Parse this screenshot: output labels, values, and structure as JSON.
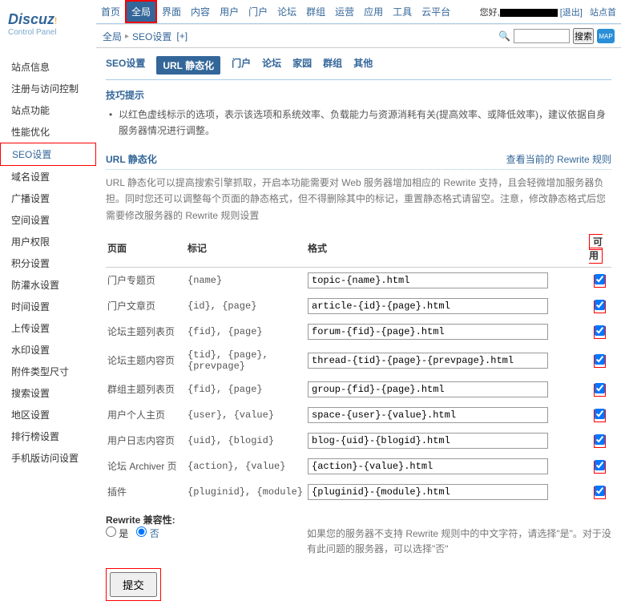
{
  "logo": {
    "main": "Discuz",
    "excl": "!",
    "sub": "Control Panel"
  },
  "topnav": {
    "items": [
      "首页",
      "全局",
      "界面",
      "内容",
      "用户",
      "门户",
      "论坛",
      "群组",
      "运营",
      "应用",
      "工具",
      "云平台"
    ],
    "active_index": 1
  },
  "user": {
    "hello": "您好,",
    "logout": "[退出]",
    "site_home": "站点首"
  },
  "breadcrumb": {
    "a": "全局",
    "b": "SEO设置",
    "plus": "[+]",
    "search_btn": "搜索",
    "map": "MAP"
  },
  "sidebar": {
    "items": [
      "站点信息",
      "注册与访问控制",
      "站点功能",
      "性能优化",
      "SEO设置",
      "域名设置",
      "广播设置",
      "空间设置",
      "用户权限",
      "积分设置",
      "防灌水设置",
      "时间设置",
      "上传设置",
      "水印设置",
      "附件类型尺寸",
      "搜索设置",
      "地区设置",
      "排行榜设置",
      "手机版访问设置"
    ],
    "active_index": 4
  },
  "tabs": {
    "items": [
      "SEO设置",
      "URL 静态化",
      "门户",
      "论坛",
      "家园",
      "群组",
      "其他"
    ],
    "active_index": 1
  },
  "tips": {
    "title": "技巧提示",
    "body": "以红色虚线标示的选项，表示该选项和系统效率、负载能力与资源消耗有关(提高效率、或降低效率)，建议依据自身服务器情况进行调整。"
  },
  "section": {
    "title": "URL 静态化",
    "right_link": "查看当前的 Rewrite 规则",
    "desc": "URL 静态化可以提高搜索引擎抓取，开启本功能需要对 Web 服务器增加相应的 Rewrite 支持，且会轻微增加服务器负担。同时您还可以调整每个页面的静态格式，但不得删除其中的标记，重置静态格式请留空。注意，修改静态格式后您需要修改服务器的 Rewrite 规则设置"
  },
  "table": {
    "headers": {
      "page": "页面",
      "tag": "标记",
      "format": "格式",
      "avail": "可用"
    },
    "rows": [
      {
        "page": "门户专题页",
        "tag": "{name}",
        "format": "topic-{name}.html",
        "avail": true
      },
      {
        "page": "门户文章页",
        "tag": "{id}, {page}",
        "format": "article-{id}-{page}.html",
        "avail": true
      },
      {
        "page": "论坛主题列表页",
        "tag": "{fid}, {page}",
        "format": "forum-{fid}-{page}.html",
        "avail": true
      },
      {
        "page": "论坛主题内容页",
        "tag": "{tid}, {page}, {prevpage}",
        "format": "thread-{tid}-{page}-{prevpage}.html",
        "avail": true
      },
      {
        "page": "群组主题列表页",
        "tag": "{fid}, {page}",
        "format": "group-{fid}-{page}.html",
        "avail": true
      },
      {
        "page": "用户个人主页",
        "tag": "{user}, {value}",
        "format": "space-{user}-{value}.html",
        "avail": true
      },
      {
        "page": "用户日志内容页",
        "tag": "{uid}, {blogid}",
        "format": "blog-{uid}-{blogid}.html",
        "avail": true
      },
      {
        "page": "论坛 Archiver 页",
        "tag": "{action}, {value}",
        "format": "{action}-{value}.html",
        "avail": true
      },
      {
        "page": "插件",
        "tag": "{pluginid}, {module}",
        "format": "{pluginid}-{module}.html",
        "avail": true
      }
    ]
  },
  "compat": {
    "label": "Rewrite 兼容性:",
    "yes": "是",
    "no": "否",
    "note": "如果您的服务器不支持 Rewrite 规则中的中文字符，请选择\"是\"。对于没有此问题的服务器，可以选择\"否\""
  },
  "submit": {
    "label": "提交"
  }
}
